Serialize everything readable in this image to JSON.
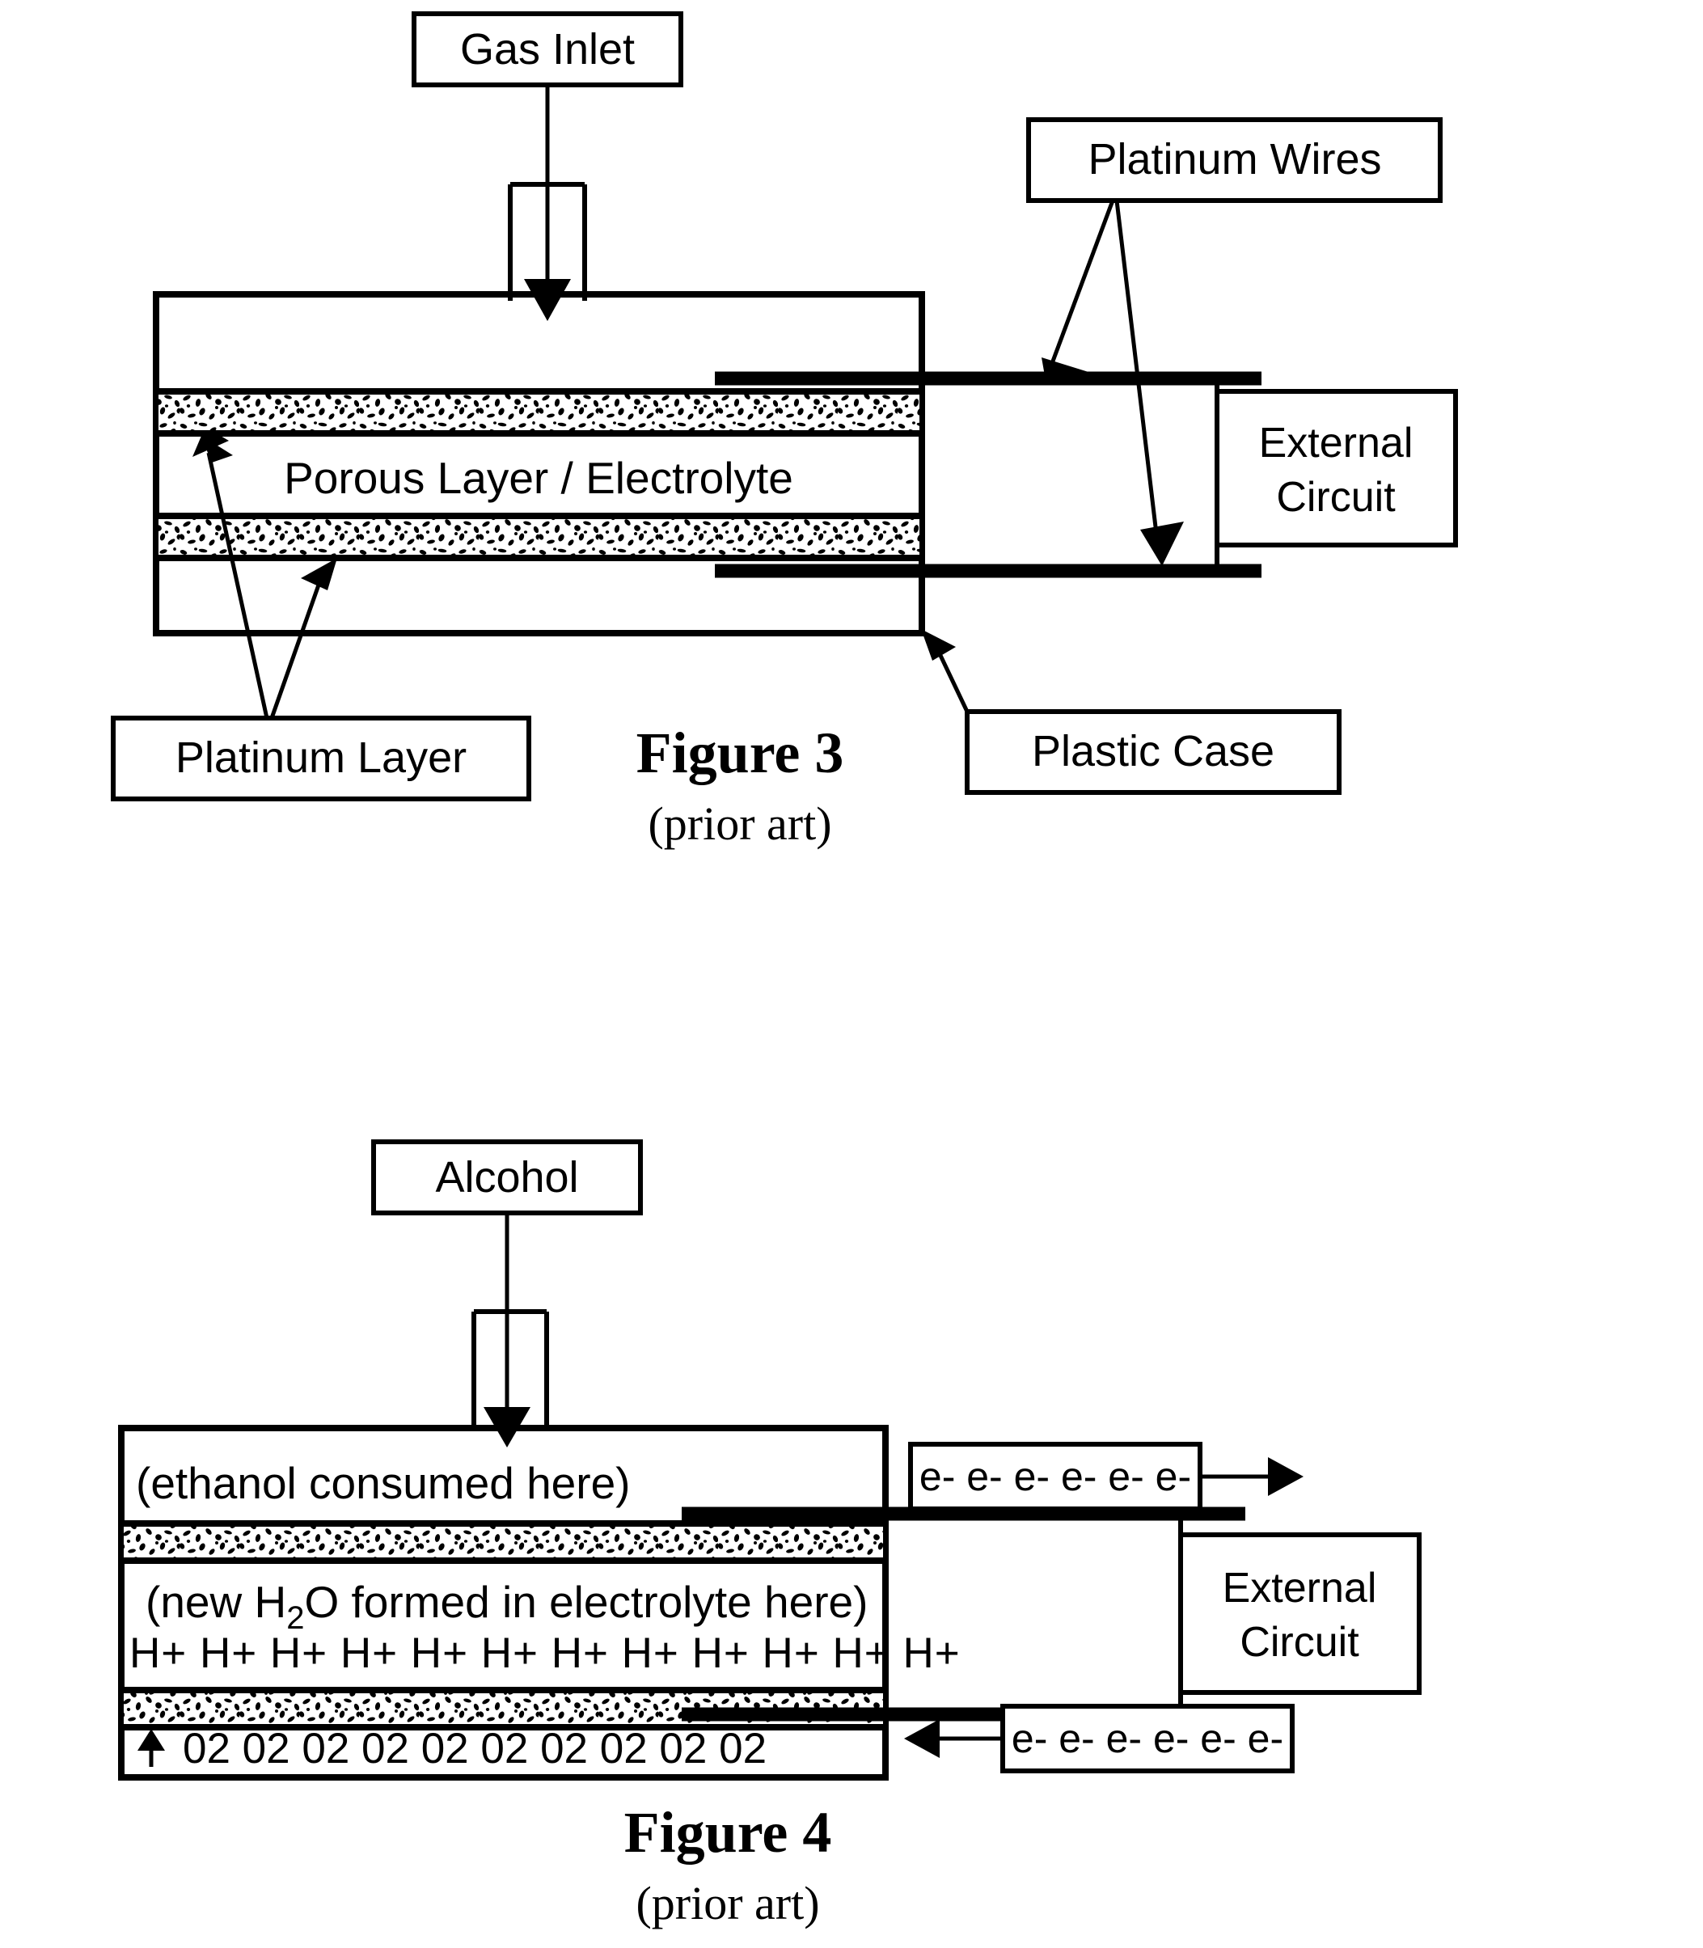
{
  "document": {
    "type": "patent-figure-sheet",
    "figures": [
      "Figure 3",
      "Figure 4"
    ]
  },
  "figure3": {
    "caption_main": "Figure 3",
    "caption_sub": "(prior art)",
    "labels": {
      "gas_inlet": "Gas Inlet",
      "platinum_wires": "Platinum Wires",
      "external_circuit_line1": "External",
      "external_circuit_line2": "Circuit",
      "platinum_layer": "Platinum Layer",
      "plastic_case": "Plastic Case",
      "porous_layer": "Porous Layer / Electrolyte"
    },
    "icons": {
      "inlet_arrow": "down-arrow-icon",
      "wire_pointer_upper": "arrow-pointer-icon",
      "wire_pointer_lower": "arrow-pointer-icon",
      "platinum_pointer_upper": "arrow-pointer-icon",
      "platinum_pointer_lower": "arrow-pointer-icon",
      "case_pointer": "arrow-pointer-icon"
    }
  },
  "figure4": {
    "caption_main": "Figure 4",
    "caption_sub": "(prior art)",
    "labels": {
      "alcohol": "Alcohol",
      "anode_note": "(ethanol consumed here)",
      "electrolyte_note": "(new H2O formed in electrolyte here)",
      "electrolyte_note_pre": "(new H",
      "electrolyte_note_sub": "2",
      "electrolyte_note_post": "O formed in electrolyte here)",
      "proton_symbol": "H+",
      "proton_count": 12,
      "proton_row": "H+ H+ H+ H+ H+ H+ H+ H+ H+ H+ H+ H+",
      "oxygen_symbol_pre": "0",
      "oxygen_symbol_sub": "2",
      "oxygen_count": 10,
      "oxygen_row": "02 02 02 02 02 02 02 02 02 02",
      "electron_symbol": "e-",
      "electron_count_top": 6,
      "electron_count_bottom": 6,
      "electron_row_top": "e- e- e- e- e- e-",
      "electron_row_bottom": "e- e- e- e- e- e-",
      "external_circuit_line1": "External",
      "external_circuit_line2": "Circuit"
    },
    "icons": {
      "inlet_arrow": "down-arrow-icon",
      "oxygen_up_arrow": "up-arrow-icon",
      "electron_out_arrow": "right-arrow-icon",
      "electron_in_arrow": "left-arrow-icon"
    }
  },
  "colors": {
    "ink": "#000000",
    "paper": "#ffffff"
  }
}
